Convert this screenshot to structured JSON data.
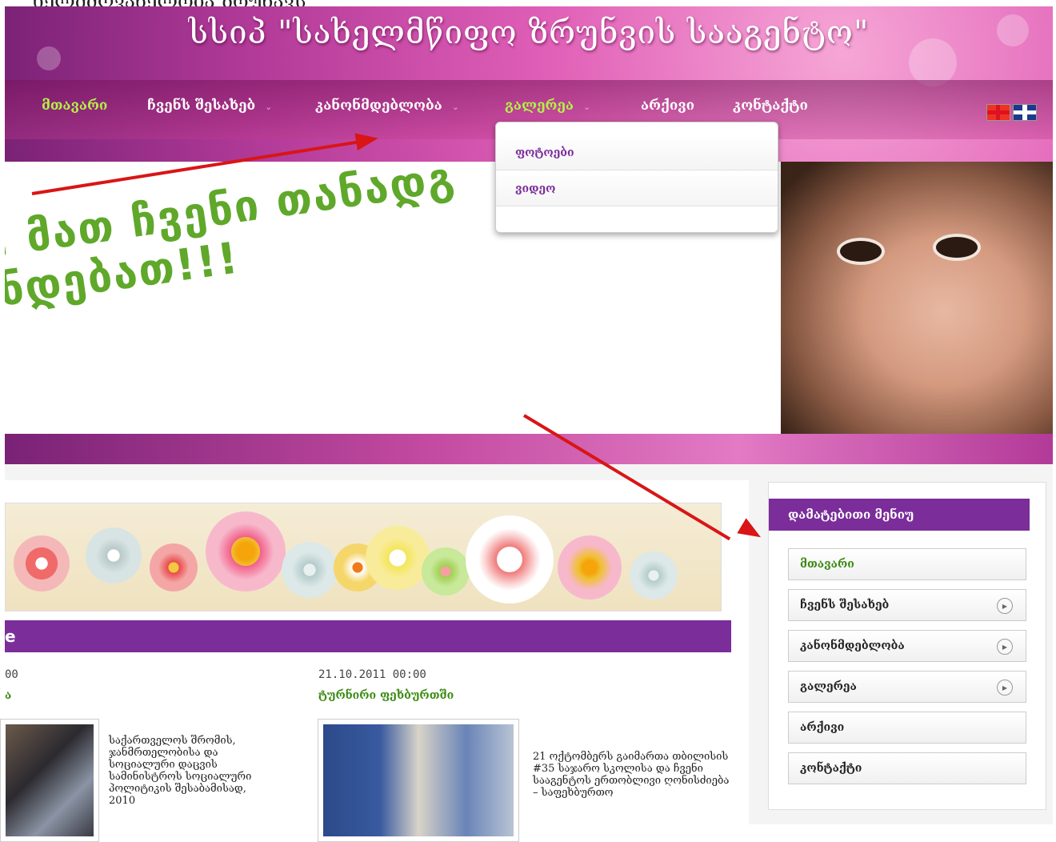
{
  "page_top_text": "ხელმძღვანელობა ზრუნავს",
  "header": {
    "site_title": "სსიპ \"სახელმწიფო ზრუნვის სააგენტო\""
  },
  "nav": {
    "items": [
      {
        "label": "მთავარი",
        "active": true,
        "has_submenu": false
      },
      {
        "label": "ჩვენს შესახებ",
        "active": false,
        "has_submenu": true
      },
      {
        "label": "კანონმდებლობა",
        "active": false,
        "has_submenu": true
      },
      {
        "label": "გალერეა",
        "active": true,
        "has_submenu": true
      },
      {
        "label": "არქივი",
        "active": false,
        "has_submenu": false
      },
      {
        "label": "კონტაქტი",
        "active": false,
        "has_submenu": false
      }
    ],
    "chevron": "⌄",
    "flags": [
      "georgia-flag-icon",
      "uk-flag-icon"
    ]
  },
  "dropdown": {
    "items": [
      "ფოტოები",
      "ვიდეო"
    ]
  },
  "hero": {
    "line1": ", მათ ჩვენი თანადგ",
    "line2": "ნდებათ!!!"
  },
  "content": {
    "section_title": "e",
    "news": [
      {
        "date": "00",
        "title": "ა",
        "text": "საქართველოს შრომის, ჯანმრთელობისა და სოციალური დაცვის სამინისტროს სოციალური პოლიტიკის შესაბამისად, 2010"
      },
      {
        "date": "21.10.2011 00:00",
        "title": "ტურნირი ფეხბურთში",
        "text": "21 ოქტომბერს გაიმართა თბილისის #35 საჯარო სკოლისა და ჩვენი სააგენტოს ერთობლივი ღონისძიება – საფეხბურთო"
      }
    ]
  },
  "sidebar": {
    "title": "დამატებითი მენიუ",
    "items": [
      {
        "label": "მთავარი",
        "active": true,
        "has_arrow": false
      },
      {
        "label": "ჩვენს შესახებ",
        "active": false,
        "has_arrow": true
      },
      {
        "label": "კანონმდებლობა",
        "active": false,
        "has_arrow": true
      },
      {
        "label": "გალერეა",
        "active": false,
        "has_arrow": true
      },
      {
        "label": "არქივი",
        "active": false,
        "has_arrow": false
      },
      {
        "label": "კონტაქტი",
        "active": false,
        "has_arrow": false
      }
    ],
    "arrow_glyph": "▶"
  },
  "colors": {
    "accent_purple": "#7b2d9a",
    "accent_green": "#3a8a12",
    "nav_active": "#b4f046",
    "annotation_red": "#d91515"
  }
}
